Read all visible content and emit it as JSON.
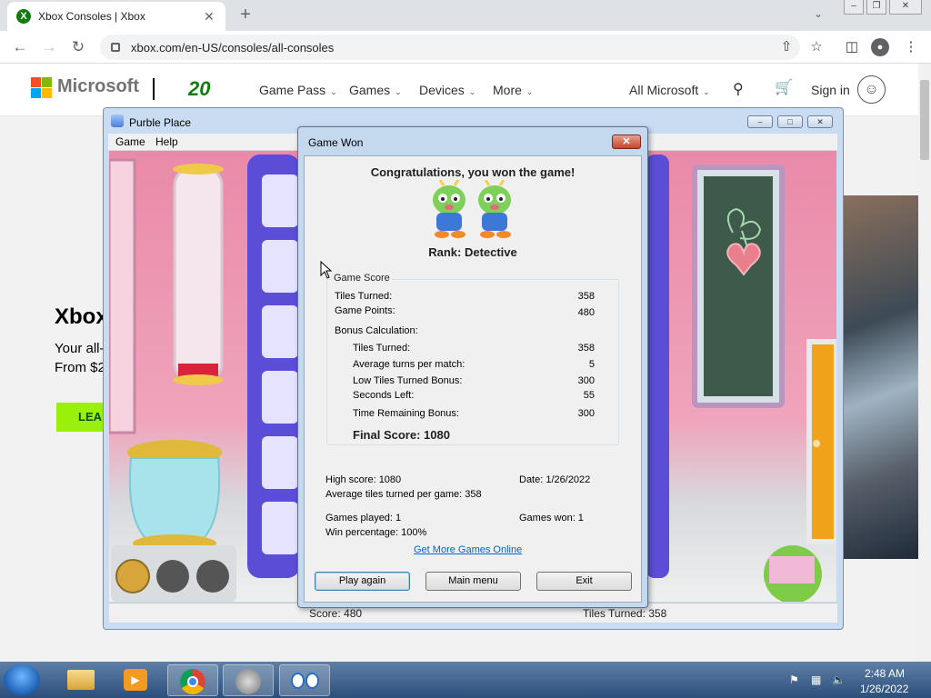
{
  "browser": {
    "tab_title": "Xbox Consoles | Xbox",
    "tab_favicon_letter": "X",
    "url": "xbox.com/en-US/consoles/all-consoles",
    "new_tab_symbol": "+",
    "close_tab_symbol": "✕"
  },
  "site": {
    "brand": "Microsoft",
    "xbox_20": "20",
    "nav": [
      "Game Pass",
      "Games",
      "Devices",
      "More"
    ],
    "all_microsoft": "All Microsoft",
    "sign_in": "Sign in",
    "hero_title": "Xbox",
    "hero_sub1": "Your all-",
    "hero_sub2": "From $2",
    "learn_btn": "LEA"
  },
  "game_window": {
    "title": "Purble Place",
    "menu": [
      "Game",
      "Help"
    ],
    "status_score": "Score: 480",
    "status_tiles": "Tiles Turned: 358"
  },
  "dialog": {
    "title": "Game Won",
    "close": "✕",
    "congrats": "Congratulations, you won the game!",
    "rank": "Rank: Detective",
    "group_label": "Game Score",
    "tiles_turned_label": "Tiles Turned:",
    "tiles_turned": "358",
    "game_points_label": "Game Points:",
    "game_points": "480",
    "bonus_label": "Bonus Calculation:",
    "bonus_tiles_label": "Tiles Turned:",
    "bonus_tiles": "358",
    "avg_turns_label": "Average turns per match:",
    "avg_turns": "5",
    "low_tiles_label": "Low Tiles Turned Bonus:",
    "low_tiles": "300",
    "seconds_left_label": "Seconds Left:",
    "seconds_left": "55",
    "time_bonus_label": "Time Remaining Bonus:",
    "time_bonus": "300",
    "final_score": "Final Score: 1080",
    "high_score": "High score: 1080",
    "date": "Date: 1/26/2022",
    "avg_tiles": "Average tiles turned per game: 358",
    "games_played": "Games played: 1",
    "games_won": "Games won: 1",
    "win_pct": "Win percentage: 100%",
    "get_more": "Get More Games Online",
    "btn_play": "Play again",
    "btn_main": "Main menu",
    "btn_exit": "Exit"
  },
  "taskbar": {
    "time": "2:48 AM",
    "date": "1/26/2022"
  },
  "colors": {
    "xbox_green": "#107c10",
    "learn_btn": "#9bf00b",
    "dialog_frame": "#c4d8ee"
  }
}
